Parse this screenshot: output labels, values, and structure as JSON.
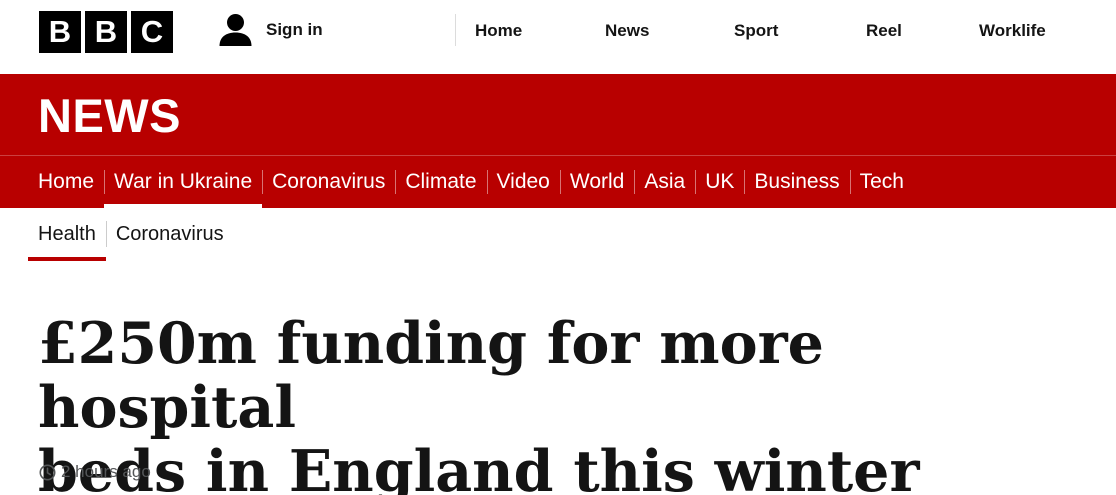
{
  "header": {
    "logo_letters": [
      "B",
      "B",
      "C"
    ],
    "signin_label": "Sign in",
    "nav": [
      "Home",
      "News",
      "Sport",
      "Reel",
      "Worklife"
    ]
  },
  "banner": {
    "title": "NEWS"
  },
  "section_nav": {
    "items": [
      "Home",
      "War in Ukraine",
      "Coronavirus",
      "Climate",
      "Video",
      "World",
      "Asia",
      "UK",
      "Business",
      "Tech"
    ],
    "active_index": 1
  },
  "sub_nav": {
    "items": [
      "Health",
      "Coronavirus"
    ],
    "active_index": 0
  },
  "article": {
    "headline_line1": "£250m funding for more hospital",
    "headline_line2": "beds in England this winter",
    "timestamp": "2 hours ago"
  },
  "colors": {
    "brand_red": "#b80000",
    "text": "#141414",
    "muted": "#545658"
  }
}
